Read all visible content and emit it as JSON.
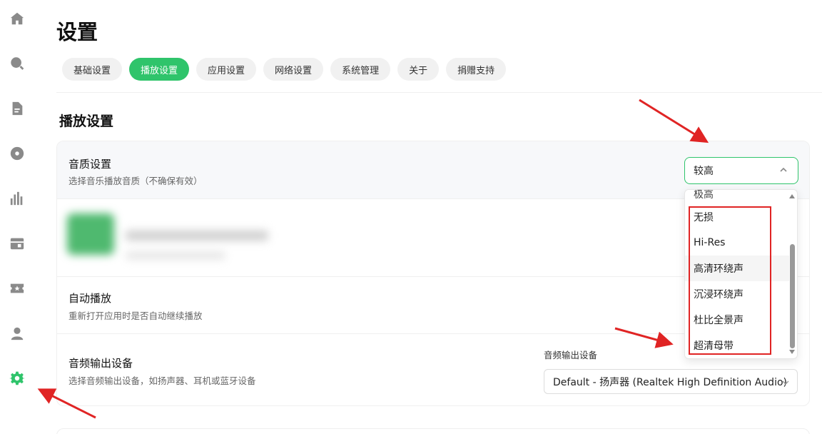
{
  "sidebar": {
    "items": [
      {
        "icon": "home-icon"
      },
      {
        "icon": "search-icon"
      },
      {
        "icon": "document-icon"
      },
      {
        "icon": "disc-icon"
      },
      {
        "icon": "chart-icon"
      },
      {
        "icon": "radio-icon"
      },
      {
        "icon": "ticket-icon"
      },
      {
        "icon": "user-icon"
      },
      {
        "icon": "gear-icon",
        "active": true
      }
    ],
    "active_color": "#2fc46b"
  },
  "header": {
    "title": "设置",
    "tabs": [
      {
        "label": "基础设置"
      },
      {
        "label": "播放设置",
        "active": true
      },
      {
        "label": "应用设置"
      },
      {
        "label": "网络设置"
      },
      {
        "label": "系统管理"
      },
      {
        "label": "关于"
      },
      {
        "label": "捐赠支持"
      }
    ]
  },
  "section": {
    "title": "播放设置"
  },
  "settings": {
    "quality": {
      "title": "音质设置",
      "desc": "选择音乐播放音质（不确保有效）",
      "selected": "较高",
      "options": [
        "极高",
        "无损",
        "Hi-Res",
        "高清环绕声",
        "沉浸环绕声",
        "杜比全景声",
        "超清母带"
      ],
      "hovered_option": "高清环绕声"
    },
    "autoplay": {
      "title": "自动播放",
      "desc": "重新打开应用时是否自动继续播放"
    },
    "output": {
      "title": "音频输出设备",
      "desc": "选择音频输出设备，如扬声器、耳机或蓝牙设备",
      "label": "音频输出设备",
      "selected": "Default - 扬声器 (Realtek High Definition Audio)"
    }
  },
  "colors": {
    "accent": "#2fc46b",
    "annotation": "#e02424"
  }
}
